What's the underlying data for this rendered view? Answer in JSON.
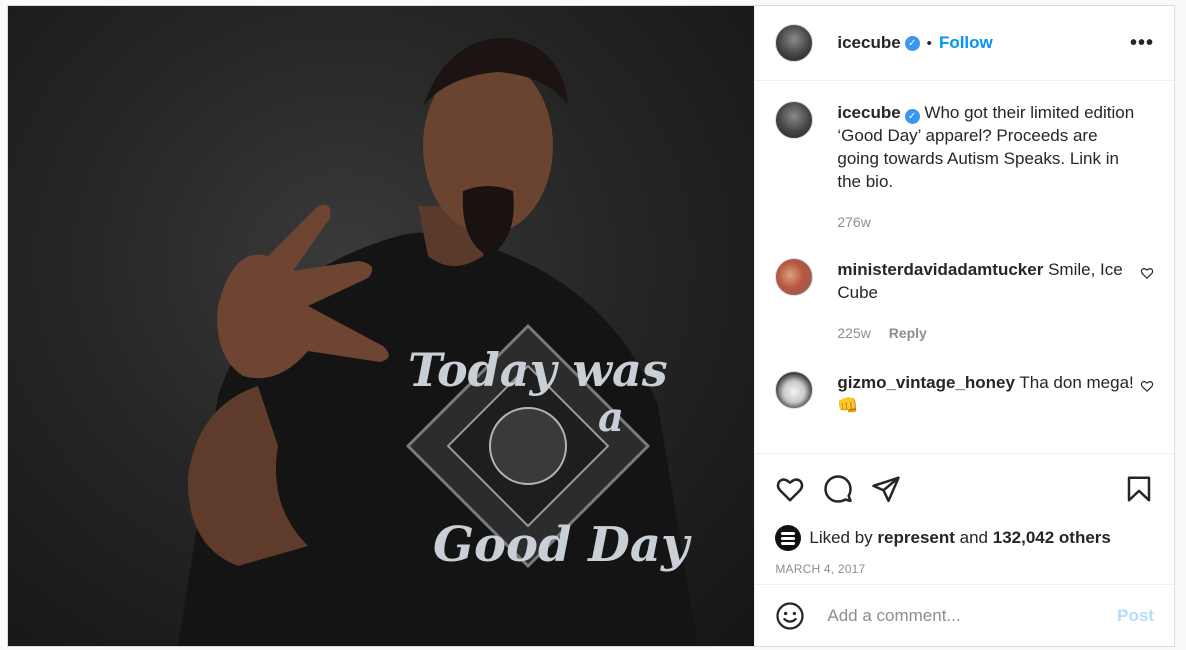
{
  "post": {
    "image_icon": "photo-portrait",
    "shirt_text": "Today was a Good Day"
  },
  "header": {
    "username": "icecube",
    "verified": true,
    "separator": "•",
    "follow_label": "Follow",
    "more_icon": "more-horizontal-icon"
  },
  "caption": {
    "username": "icecube",
    "text": "Who got their limited edition ‘Good Day’ apparel? Proceeds are going towards Autism Speaks. Link in the bio.",
    "time": "276w"
  },
  "comments": [
    {
      "username": "ministerdavidadamtucker",
      "text": "Smile, Ice Cube",
      "time": "225w",
      "reply_label": "Reply"
    },
    {
      "username": "gizmo_vintage_honey",
      "text": "Tha don mega!",
      "emoji": "👊"
    }
  ],
  "actions": {
    "like_icon": "heart-icon",
    "comment_icon": "comment-icon",
    "share_icon": "share-icon",
    "save_icon": "bookmark-icon"
  },
  "likes": {
    "prefix": "Liked by",
    "user": "represent",
    "conjunction": "and",
    "others": "132,042 others"
  },
  "date": "MARCH 4, 2017",
  "add_comment": {
    "placeholder": "Add a comment...",
    "post_label": "Post"
  },
  "colors": {
    "accent": "#0095f6",
    "post_disabled": "#b2dffc",
    "verified": "#3897f0",
    "muted": "#8e8e8e"
  }
}
